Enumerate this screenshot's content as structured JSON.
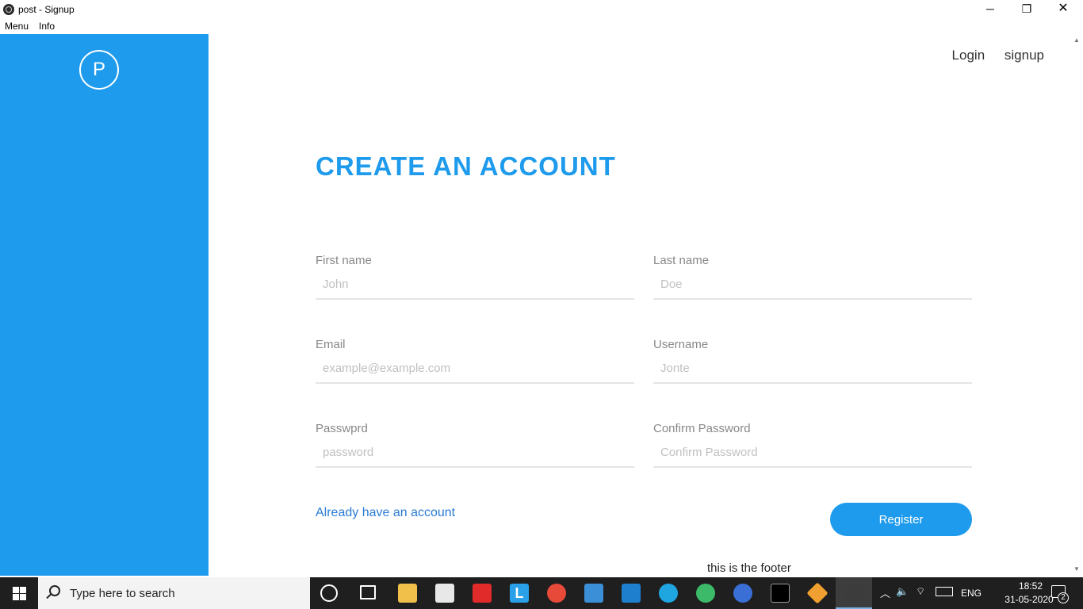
{
  "window": {
    "title": "post - Signup",
    "minimize_glyph": "─",
    "maximize_glyph": "❐",
    "close_glyph": "✕"
  },
  "menubar": {
    "items": [
      "Menu",
      "Info"
    ]
  },
  "sidebar": {
    "avatar_letter": "P",
    "background_color": "#1e9bec"
  },
  "nav": {
    "login": "Login",
    "signup": "signup"
  },
  "form": {
    "heading": "CREATE AN ACCOUNT",
    "first_name": {
      "label": "First name",
      "placeholder": "John"
    },
    "last_name": {
      "label": "Last name",
      "placeholder": "Doe"
    },
    "email": {
      "label": "Email",
      "placeholder": "example@example.com"
    },
    "username": {
      "label": "Username",
      "placeholder": "Jonte"
    },
    "password": {
      "label": "Passwprd",
      "placeholder": "password"
    },
    "confirm_password": {
      "label": "Confirm Password",
      "placeholder": "Confirm Password"
    },
    "login_link": "Already have an account",
    "register_button": "Register"
  },
  "footer": {
    "text": "this is the footer"
  },
  "taskbar": {
    "search_placeholder": "Type here to search",
    "l_app_letter": "L",
    "language": "ENG",
    "time": "18:52",
    "date": "31-05-2020",
    "notification_count": "2",
    "icons": [
      "windows-start-icon",
      "search-icon",
      "cortana-icon",
      "task-view-icon",
      "file-explorer-icon",
      "microsoft-store-icon",
      "red-app-icon",
      "l-app-icon",
      "chrome-icon",
      "mail-icon",
      "vscode-icon",
      "skype-icon",
      "android-studio-icon",
      "chromium-icon",
      "terminal-icon",
      "git-icon",
      "electron-icon"
    ]
  },
  "colors": {
    "accent": "#1e9bec",
    "link": "#2a7bd6",
    "taskbar": "#1f1f1f"
  }
}
